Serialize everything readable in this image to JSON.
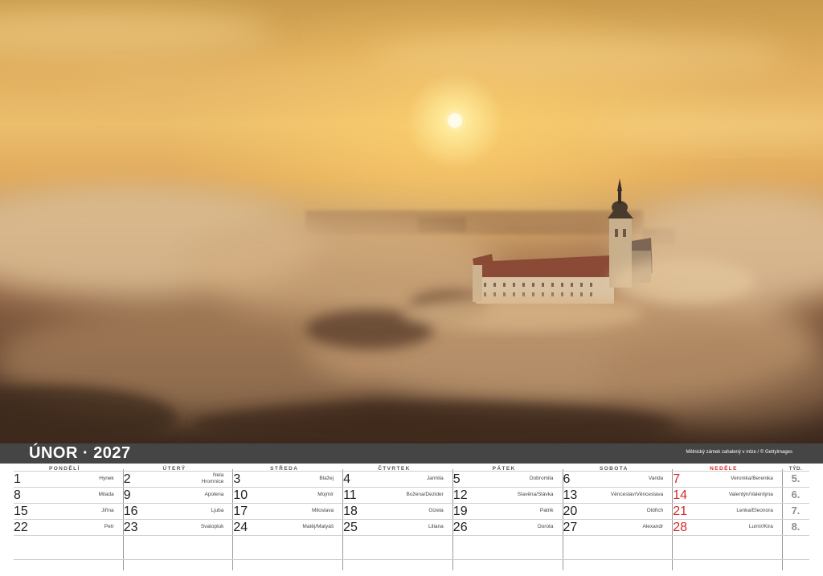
{
  "header": {
    "month": "ÚNOR",
    "separator": "·",
    "year": "2027",
    "photo_credit": "Mělnický zámek zahalený v mlze / © GettyImages"
  },
  "day_headers": [
    "PONDĚLÍ",
    "ÚTERÝ",
    "STŘEDA",
    "ČTVRTEK",
    "PÁTEK",
    "SOBOTA",
    "NEDĚLE"
  ],
  "week_header": "TÝD.",
  "weeks": [
    {
      "week": "5.",
      "days": [
        {
          "num": "1",
          "name": "Hynek"
        },
        {
          "num": "2",
          "name": "Nela\nHromnice"
        },
        {
          "num": "3",
          "name": "Blažej"
        },
        {
          "num": "4",
          "name": "Jarmila"
        },
        {
          "num": "5",
          "name": "Dobromila"
        },
        {
          "num": "6",
          "name": "Vanda"
        },
        {
          "num": "7",
          "name": "Veronika/Berenika"
        }
      ]
    },
    {
      "week": "6.",
      "days": [
        {
          "num": "8",
          "name": "Milada"
        },
        {
          "num": "9",
          "name": "Apolena"
        },
        {
          "num": "10",
          "name": "Mojmír"
        },
        {
          "num": "11",
          "name": "Božena/Dezider"
        },
        {
          "num": "12",
          "name": "Slavěna/Slávka"
        },
        {
          "num": "13",
          "name": "Věnceslav/Věnceslava"
        },
        {
          "num": "14",
          "name": "Valentýn/Valentýna"
        }
      ]
    },
    {
      "week": "7.",
      "days": [
        {
          "num": "15",
          "name": "Jiřina"
        },
        {
          "num": "16",
          "name": "Ljuba"
        },
        {
          "num": "17",
          "name": "Miloslava"
        },
        {
          "num": "18",
          "name": "Gizela"
        },
        {
          "num": "19",
          "name": "Patrik"
        },
        {
          "num": "20",
          "name": "Oldřich"
        },
        {
          "num": "21",
          "name": "Lenka/Eleonora"
        }
      ]
    },
    {
      "week": "8.",
      "days": [
        {
          "num": "22",
          "name": "Petr"
        },
        {
          "num": "23",
          "name": "Svatopluk"
        },
        {
          "num": "24",
          "name": "Matěj/Matyáš"
        },
        {
          "num": "25",
          "name": "Liliana"
        },
        {
          "num": "26",
          "name": "Dorota"
        },
        {
          "num": "27",
          "name": "Alexandr"
        },
        {
          "num": "28",
          "name": "Lumír/Kira"
        }
      ]
    }
  ],
  "colors": {
    "header_bar": "#454545",
    "sunday": "#d42a2a",
    "week_number": "#8f8f8f"
  }
}
